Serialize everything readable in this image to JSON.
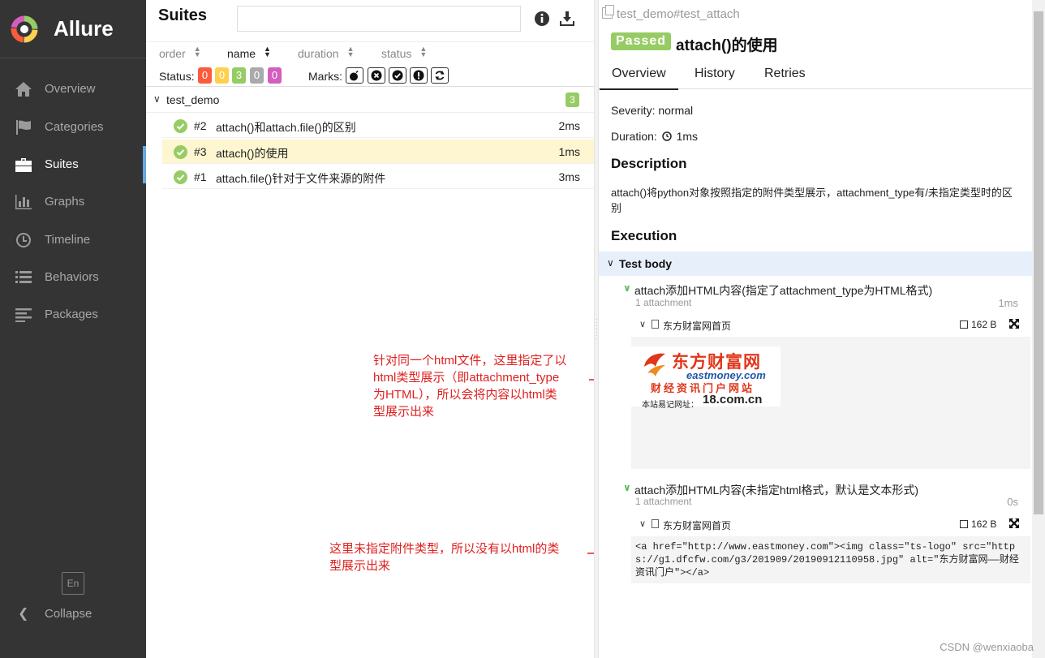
{
  "app": {
    "name": "Allure"
  },
  "sidebar": {
    "items": [
      {
        "label": "Overview",
        "icon": "home-icon"
      },
      {
        "label": "Categories",
        "icon": "flag-icon"
      },
      {
        "label": "Suites",
        "icon": "briefcase-icon",
        "active": true
      },
      {
        "label": "Graphs",
        "icon": "bar-chart-icon"
      },
      {
        "label": "Timeline",
        "icon": "clock-icon"
      },
      {
        "label": "Behaviors",
        "icon": "list-icon"
      },
      {
        "label": "Packages",
        "icon": "align-left-icon"
      }
    ],
    "language": "En",
    "collapse_label": "Collapse"
  },
  "suites": {
    "title": "Suites",
    "search_placeholder": "",
    "sort": {
      "order": "order",
      "name": "name",
      "duration": "duration",
      "status": "status"
    },
    "status_label": "Status:",
    "status_counts": [
      {
        "value": "0",
        "color": "#fd5a3e"
      },
      {
        "value": "0",
        "color": "#ffd050"
      },
      {
        "value": "3",
        "color": "#97cc64"
      },
      {
        "value": "0",
        "color": "#aaaaaa"
      },
      {
        "value": "0",
        "color": "#d35ebe"
      }
    ],
    "marks_label": "Marks:",
    "group": {
      "name": "test_demo",
      "count": "3"
    },
    "tests": [
      {
        "num": "#2",
        "name": "attach()和attach.file()的区别",
        "duration": "2ms"
      },
      {
        "num": "#3",
        "name": "attach()的使用",
        "duration": "1ms",
        "selected": true
      },
      {
        "num": "#1",
        "name": "attach.file()针对于文件来源的附件",
        "duration": "3ms"
      }
    ]
  },
  "annotations": {
    "first": [
      "针对同一个html文件，这里指定了以",
      "html类型展示（即attachment_type",
      "为HTML），所以会将内容以html类",
      "型展示出来"
    ],
    "second": [
      "这里未指定附件类型，所以没有以html的类",
      "型展示出来"
    ],
    "color": "#e02020"
  },
  "detail": {
    "breadcrumb": "test_demo#test_attach",
    "status": "Passed",
    "title": "attach()的使用",
    "tabs": [
      "Overview",
      "History",
      "Retries"
    ],
    "severity": "Severity: normal",
    "duration_label": "Duration:",
    "duration_value": "1ms",
    "description_heading": "Description",
    "description": "attach()将python对象按照指定的附件类型展示，attachment_type有/未指定类型时的区别",
    "execution_heading": "Execution",
    "test_body_label": "Test body",
    "steps": [
      {
        "name": "attach添加HTML内容(指定了attachment_type为HTML格式)",
        "meta": "1 attachment",
        "duration": "1ms",
        "attachment": {
          "name": "东方财富网首页",
          "size": "162 B"
        }
      },
      {
        "name": "attach添加HTML内容(未指定html格式，默认是文本形式)",
        "meta": "1 attachment",
        "duration": "0s",
        "attachment": {
          "name": "东方财富网首页",
          "size": "162 B"
        }
      }
    ],
    "rendered_html": {
      "brand": "东方财富网",
      "domain": "eastmoney.com",
      "tagline": "财经资讯门户网站",
      "site_label": "本站易记网址：",
      "site": "18.com.cn"
    },
    "raw_text": "<a href=\"http://www.eastmoney.com\"><img class=\"ts-logo\" src=\"https://g1.dfcfw.com/g3/201909/20190912110958.jpg\" alt=\"东方财富网——财经资讯门户\"></a>"
  },
  "watermark": "CSDN @wenxiaoba"
}
